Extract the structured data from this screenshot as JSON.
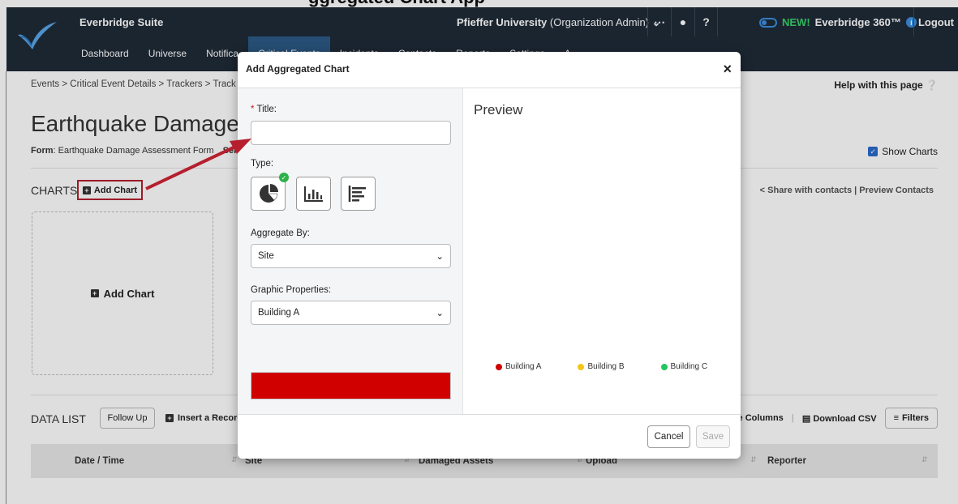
{
  "caption": "ggregated Chart App",
  "header": {
    "suite_name": "Everbridge Suite",
    "org_name": "Pfieffer University",
    "org_role": "(Organization Admin)",
    "new_badge": "NEW!",
    "product_360": "Everbridge 360™",
    "logout": "Logout"
  },
  "nav": [
    "Dashboard",
    "Universe",
    "Notifica",
    "Critical Events",
    "Incidents",
    "Contacts",
    "Reports",
    "Settings",
    "A"
  ],
  "breadcrumb": "Events > Critical Event Details > Trackers > Track",
  "help": "Help with this page",
  "page": {
    "title": "Earthquake Damages",
    "form_label": "Form",
    "form_value": ": Earthquake Damage Assessment Form",
    "form_more": "Ser",
    "show_charts": "Show Charts",
    "charts_label": "CHARTS",
    "add_chart": "Add Chart",
    "share": "Share with contacts",
    "preview_contacts": "Preview Contacts",
    "add_chart_card": "Add Chart"
  },
  "datalist": {
    "label": "DATA LIST",
    "follow_up": "Follow Up",
    "insert_record": "Insert a Record",
    "manage_columns": "e Columns",
    "download_csv": "Download CSV",
    "filters": "Filters",
    "columns": [
      "Date / Time",
      "Site",
      "Damaged Assets",
      "Upload",
      "Reporter"
    ]
  },
  "modal": {
    "title": "Add Aggregated Chart",
    "title_label": "Title:",
    "title_value": "",
    "type_label": "Type:",
    "aggregate_label": "Aggregate By:",
    "aggregate_value": "Site",
    "graphic_label": "Graphic Properties:",
    "graphic_value": "Building A",
    "swatch_color": "#d10000",
    "preview_title": "Preview",
    "legend": [
      {
        "label": "Building A",
        "color": "#d10000"
      },
      {
        "label": "Building B",
        "color": "#f5c518"
      },
      {
        "label": "Building C",
        "color": "#22c55e"
      }
    ],
    "cancel": "Cancel",
    "save": "Save"
  },
  "icons": {
    "type_options": [
      "pie-chart-icon",
      "bar-chart-icon",
      "horizontal-bar-chart-icon"
    ],
    "selected_type": "pie-chart-icon"
  }
}
